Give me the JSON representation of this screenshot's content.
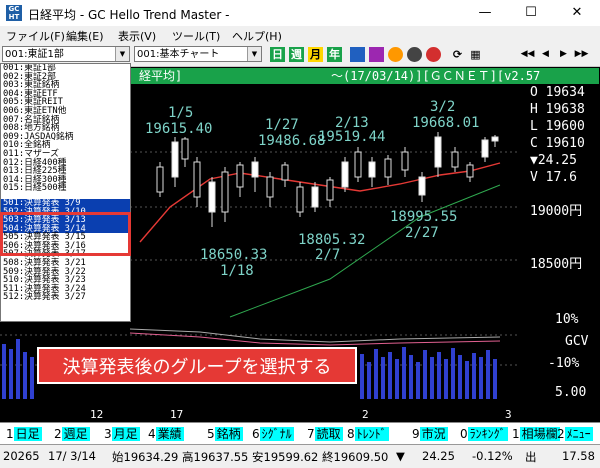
{
  "window": {
    "title": "日経平均 - GC Hello Trend Master -",
    "minimize": "—",
    "maximize": "☐",
    "close": "✕",
    "icon_text": "GC HT"
  },
  "menu": [
    "ファイル(F)",
    "編集(E)",
    "表示(V)",
    "ツール(T)",
    "ヘルプ(H)"
  ],
  "toolbar": {
    "group_select": "001:東証1部",
    "chart_select": "001:基本チャート",
    "buttons": [
      "日",
      "週",
      "月",
      "年",
      "icon",
      "icon",
      "icon",
      "icon",
      "icon"
    ],
    "nav": [
      "◀◀",
      "◀",
      "▶",
      "▶▶"
    ]
  },
  "chart_header": {
    "left": "経平均]",
    "right": "～(17/03/14)][ＧＣＮＥＴ][v2.57"
  },
  "dropdown_items": [
    "001:東証1部",
    "002:東証2部",
    "003:東証銘柄",
    "004:東証ETF",
    "005:東証REIT",
    "006:東証ETN他",
    "007:名証銘柄",
    "008:地方銘柄",
    "009:JASDAQ銘柄",
    "010:全銘柄",
    "011:マザーズ",
    "012:日経400種",
    "013:日経225種",
    "014:日経300種",
    "015:日経500種",
    "501:決算発表 3/9",
    "502:決算発表 3/10",
    "503:決算発表 3/13",
    "504:決算発表 3/14",
    "505:決算発表 3/15",
    "506:決算発表 3/16",
    "507:決算発表 3/17",
    "508:決算発表 3/21",
    "509:決算発表 3/22",
    "510:決算発表 3/23",
    "511:決算発表 3/24",
    "512:決算発表 3/27"
  ],
  "ohlc": {
    "o": "O 19634",
    "h": "H 19638",
    "l": "L 19600",
    "c": "C 19610",
    "chg": "▼24.25",
    "v": "V 17.6"
  },
  "price_labels": {
    "p1": "1/5",
    "p1v": "19615.40",
    "p2": "1/27",
    "p2v": "19486.68",
    "p3": "2/13",
    "p3v": "19519.44",
    "p4": "3/2",
    "p4v": "19668.01",
    "l1": "18650.33",
    "l1d": "1/18",
    "l2": "18805.32",
    "l2d": "2/7",
    "l3": "18995.55",
    "l3d": "2/27"
  },
  "axis": {
    "y1": "19000円",
    "y2": "18500円",
    "s1": "10%",
    "s2": "GCV",
    "s3": "-10%",
    "s4": "5.00"
  },
  "time_axis": [
    "12",
    "17",
    "2",
    "3"
  ],
  "callout": "決算発表後のグループを選択する",
  "tabs": [
    {
      "n": "1",
      "l": "日足"
    },
    {
      "n": "2",
      "l": "週足"
    },
    {
      "n": "3",
      "l": "月足"
    },
    {
      "n": "4",
      "l": "業績"
    },
    {
      "n": "5",
      "l": "銘柄"
    },
    {
      "n": "6",
      "l": "ｼｸﾞﾅﾙ"
    },
    {
      "n": "7",
      "l": "読取"
    },
    {
      "n": "8",
      "l": "ﾄﾚﾝﾄﾞ"
    },
    {
      "n": "9",
      "l": "市況"
    },
    {
      "n": "0",
      "l": "ﾗﾝｷﾝｸﾞ"
    },
    {
      "n": "1",
      "l": "相場欄"
    },
    {
      "n": "2",
      "l": "ﾒﾆｭｰ"
    }
  ],
  "status": [
    "20265",
    "17/ 3/14",
    "始19634.29",
    "高19637.55",
    "安19599.62",
    "終19609.50",
    "▼",
    "24.25",
    "-0.12%",
    "出",
    "17.58"
  ],
  "colors": {
    "accent": "#19a24a",
    "callout": "#e53935",
    "highlight": "#0a3fb0",
    "tab": "#00ffff"
  }
}
